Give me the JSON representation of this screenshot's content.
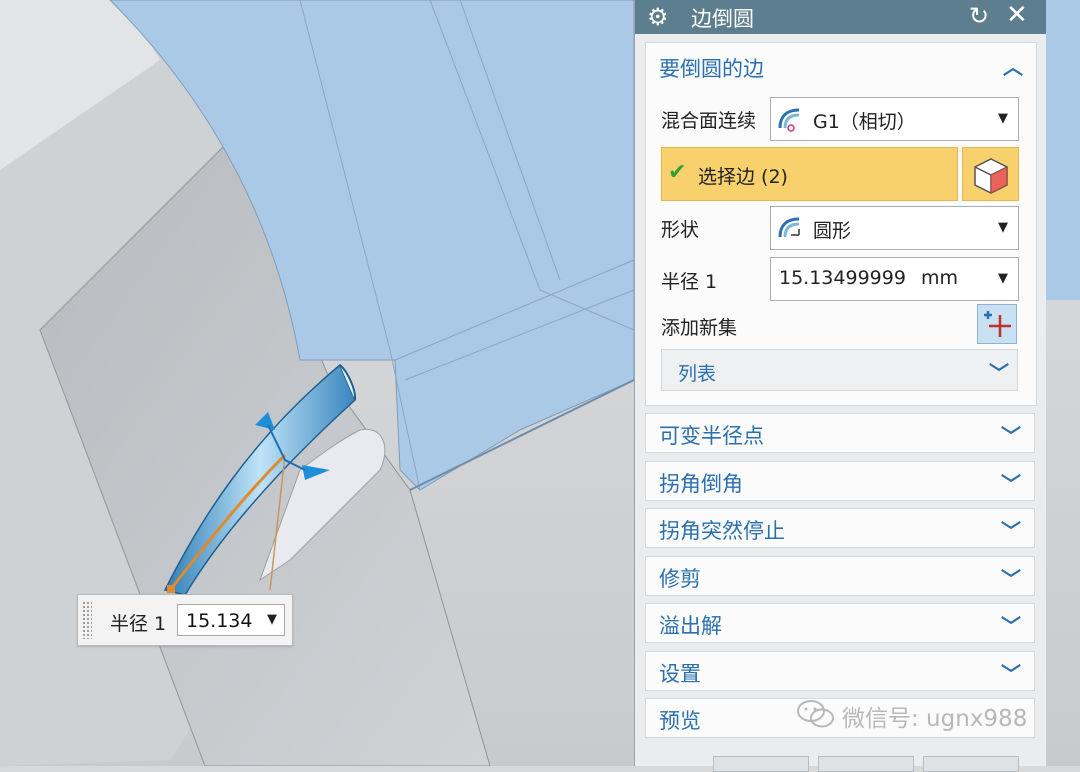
{
  "dialog": {
    "title": "边倒圆",
    "group": {
      "header": "要倒圆的边",
      "blend_label": "混合面连续",
      "blend_value": "G1（相切）",
      "select_edge_label": "选择边 (2)",
      "shape_label": "形状",
      "shape_value": "圆形",
      "radius_label": "半径 1",
      "radius_value": "15.13499999",
      "radius_unit": "mm",
      "add_set_label": "添加新集",
      "list_label": "列表"
    },
    "sections": [
      "可变半径点",
      "拐角倒角",
      "拐角突然停止",
      "修剪",
      "溢出解",
      "设置",
      "预览"
    ]
  },
  "float_input": {
    "label": "半径 1",
    "value": "15.134"
  },
  "watermark": {
    "text": "微信号: ugnx988"
  },
  "colors": {
    "title_bar": "#5d7e8e",
    "accent_blue": "#2a6fb0",
    "selection_yellow": "#f8d16c",
    "model_blue": "#a8c8e6",
    "check_green": "#34a030"
  }
}
